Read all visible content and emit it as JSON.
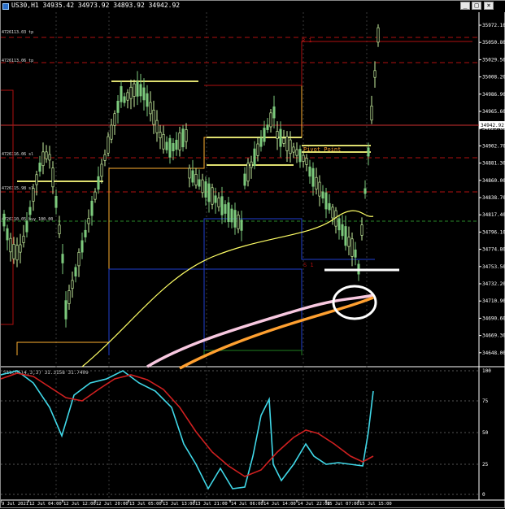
{
  "window": {
    "title": "US30,H1",
    "ohlc": "34935.42 34973.92 34893.92 34942.92",
    "buttons": {
      "minimize": "_",
      "maximize": "□",
      "close": "×"
    }
  },
  "price_axis": {
    "ticks": [
      "35972.10",
      "35050.80",
      "35029.50",
      "35008.20",
      "34986.90",
      "34965.60",
      "34923.00",
      "34902.70",
      "34881.30",
      "34860.00",
      "34838.70",
      "34817.40",
      "34796.10",
      "34774.80",
      "34753.50",
      "34732.20",
      "34710.90",
      "34690.60",
      "34669.30",
      "34648.00"
    ],
    "current_price": "34942.92"
  },
  "indicator_axis": {
    "ticks": [
      "100",
      "75",
      "50",
      "25",
      "0"
    ]
  },
  "time_axis": {
    "ticks": [
      "9 Jul 2021",
      "12 Jul 04:00",
      "12 Jul 12:00",
      "12 Jul 20:00",
      "13 Jul 05:00",
      "13 Jul 13:00",
      "13 Jul 21:00",
      "14 Jul 06:00",
      "14 Jul 14:00",
      "14 Jul 22:00",
      "15 Jul 07:00",
      "15 Jul 15:00"
    ]
  },
  "labels": {
    "r1_top": "R 1",
    "pivot": "Pivot Point",
    "s1": "S 1",
    "left_levels": [
      "4726113.03 tp",
      "4726113.06 tp",
      "4726116.06 sl",
      "4726115.98 sl",
      "4726110.05 buy 100.00"
    ]
  },
  "indicator_label": "Stoch(14,3,3) 31.3158 31.7409",
  "colors": {
    "background": "#000000",
    "bull_candle": "#7dc97d",
    "bear_candle": "#c8f0a0",
    "ma_fast": "#ffff66",
    "ma_pink": "#f8c8e0",
    "ma_orange": "#ffa030",
    "resistance": "#b01010",
    "support": "#2040d0",
    "pivot_yellow": "#ffff80",
    "stoch_main": "#40d8e8",
    "stoch_signal": "#d02020",
    "current_price_line": "#d03030",
    "annotation": "#ffffff"
  }
}
